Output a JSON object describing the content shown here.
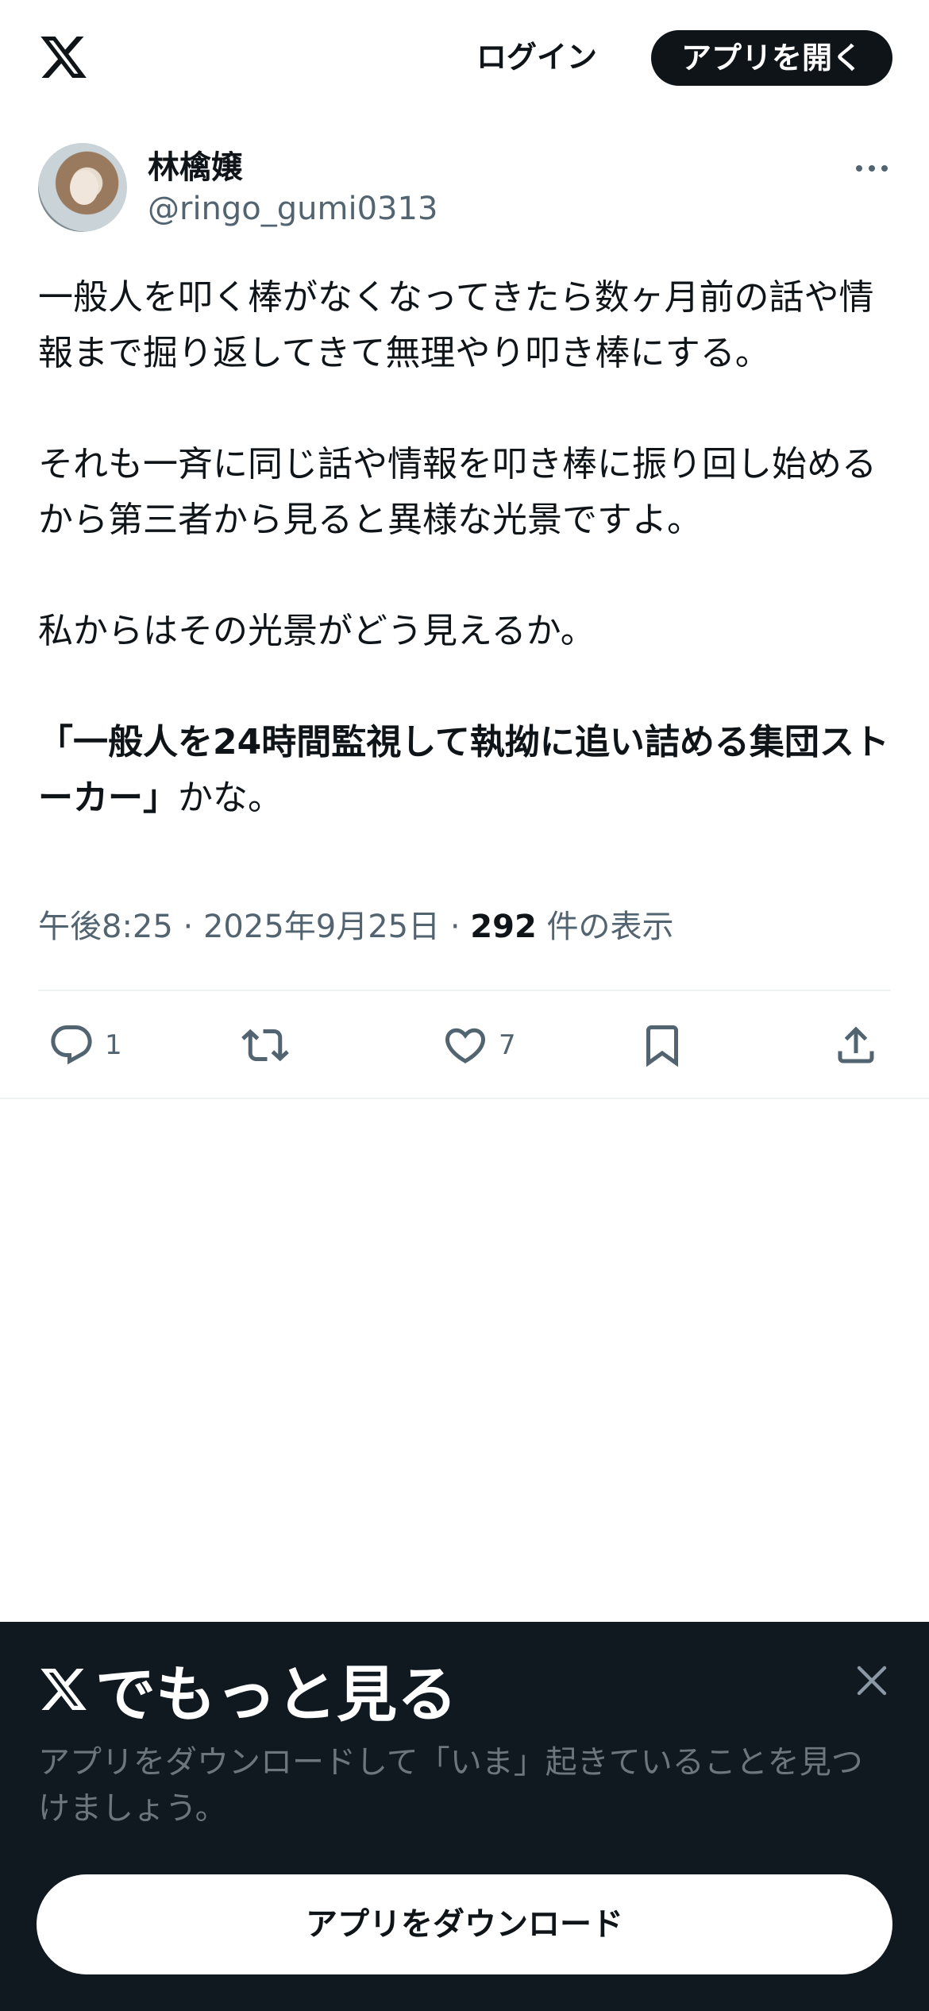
{
  "header": {
    "logo_icon": "x-logo-icon",
    "login_label": "ログイン",
    "open_app_label": "アプリを開く"
  },
  "author": {
    "display_name": "林檎嬢",
    "handle": "@ringo_gumi0313",
    "more_icon": "more-dots-icon"
  },
  "tweet": {
    "para1": "一般人を叩く棒がなくなってきたら数ヶ月前の話や情報まで掘り返してきて無理やり叩き棒にする。",
    "para2": "それも一斉に同じ話や情報を叩き棒に振り回し始めるから第三者から見ると異様な光景ですよ。",
    "para3": "私からはその光景がどう見えるか。",
    "para4_bold": "「一般人を24時間監視して執拗に追い詰める集団ストーカー」",
    "para4_tail": "かな。"
  },
  "meta": {
    "time": "午後8:25",
    "sep1": " · ",
    "date": "2025年9月25日",
    "sep2": " · ",
    "views_count": "292",
    "views_label": " 件の表示"
  },
  "actions": {
    "reply_count": "1",
    "like_count": "7",
    "icons": [
      "reply-icon",
      "retweet-icon",
      "like-icon",
      "bookmark-icon",
      "share-icon"
    ]
  },
  "sheet": {
    "title": "でもっと見る",
    "description": "アプリをダウンロードして「いま」起きていることを見つけましょう。",
    "download_label": "アプリをダウンロード"
  },
  "colors": {
    "text_primary": "#0f1419",
    "text_secondary": "#536471",
    "sheet_bg": "#101820",
    "sheet_desc": "#6e767d"
  }
}
